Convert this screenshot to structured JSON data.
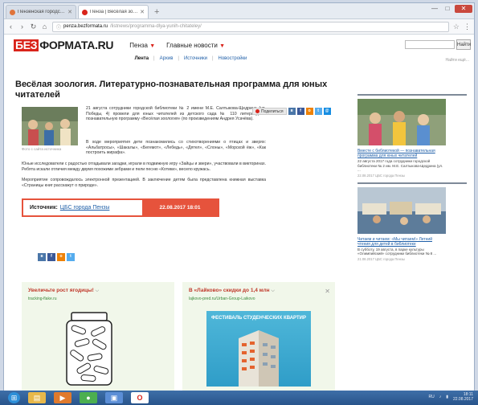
{
  "browser": {
    "tabs": [
      {
        "title": "Пензенская городская...",
        "active": false,
        "favicon_color": "#e0743b"
      },
      {
        "title": "Пенза | Весёлая зоологи...",
        "active": true,
        "favicon_color": "#d9241b"
      }
    ],
    "new_tab_label": "+",
    "url_host": "penza.bezformata.ru",
    "url_path": "/listnews/programma-dlya-yunih-chitateley/",
    "window_controls": {
      "minimize": "—",
      "maximize": "□",
      "close": "✕"
    }
  },
  "site": {
    "logo_be": "БЕЗ",
    "logo_rest": "ФОРМАТА.RU",
    "nav": [
      {
        "label": "Пенза",
        "caret": "▼"
      },
      {
        "label": "Главные новости",
        "caret": "▼"
      }
    ],
    "search_button": "Найти",
    "advanced_search": "Найти ещё...",
    "subnav": {
      "current": "Лента",
      "items": [
        "Архив",
        "Источники",
        "Новостройки"
      ]
    }
  },
  "article": {
    "title": "Весёлая зоология. Литературно-познавательная программа для юных читателей",
    "photo_caption": "Фото с сайта источника",
    "lead": "21 августа сотрудники городской библиотеки № 2 имени М.Е. Салтыкова-Щедрина (ул. Победы, 4) провели для юных читателей из детского сада № 110 литературно-познавательную программу «Весёлая зоология» (по произведениям Андрея Усачёва).",
    "p2": "В ходе мероприятия дети познакомились со стихотворениями о птицах и зверях: «Альбатросы», «Шакалы», «Бегемот», «Лебедь», «Дятел», «Слоны», «Морской ёж», «Как построить жирафа».",
    "p3": "Юные исследователи с радостью отгадывали загадки, играли в подвижную игру «Зайцы и звери», участвовали в викторинах. Ребята искали отличия между двумя похожими зебрами и пели песню «Котики», весело кружась.",
    "p4": "Мероприятие сопровождалось электронной презентацией. В заключение детям была представлена книжная выставка «Страницы книг расскажут о природе».",
    "share_label": "Поделиться",
    "source_label": "Источник:",
    "source_name": "ЦБС города Пензы",
    "date": "22.08.2017 18:01"
  },
  "ads": [
    {
      "title": "Увеличьте рост ягодицы!",
      "url": "tracking-flake.ru"
    },
    {
      "title": "В «Лайково» скидки до 1,4 млн",
      "url": "lajkovo-pred.ru/Urban-Group-Laikovo",
      "banner_text": "ФЕСТИВАЛЬ СТУДЕНЧЕСКИХ КВАРТИР"
    }
  ],
  "sidebar": [
    {
      "link": "Вместе с библиотекой — познавательная программа для юных читателей",
      "text": "22 августа 2017 года сотрудники городской библиотеки № 2 им. М.Е. Салтыкова-Щедрина (ул. ...",
      "meta": "22.08.2017 ЦБС города Пензы"
    },
    {
      "link": "Читаем и читаем: «Мы читаем!» Летний чтения для детей в библиотеке",
      "text": "В субботу, 19 августа, в парке культуры «Олимпийский» сотрудники библиотеки № 8 ...",
      "meta": "21.08.2017 ЦБС города Пензы"
    }
  ],
  "taskbar": {
    "apps": [
      "start",
      "explorer",
      "media",
      "chrome",
      "app",
      "opera"
    ],
    "time": "18:11",
    "date": "22.08.2017",
    "lang": "RU"
  },
  "colors": {
    "brand_red": "#d9241b",
    "accent_orange": "#e6533c",
    "link_blue": "#1f5fa8",
    "ad_bg": "#f1f7ea"
  }
}
